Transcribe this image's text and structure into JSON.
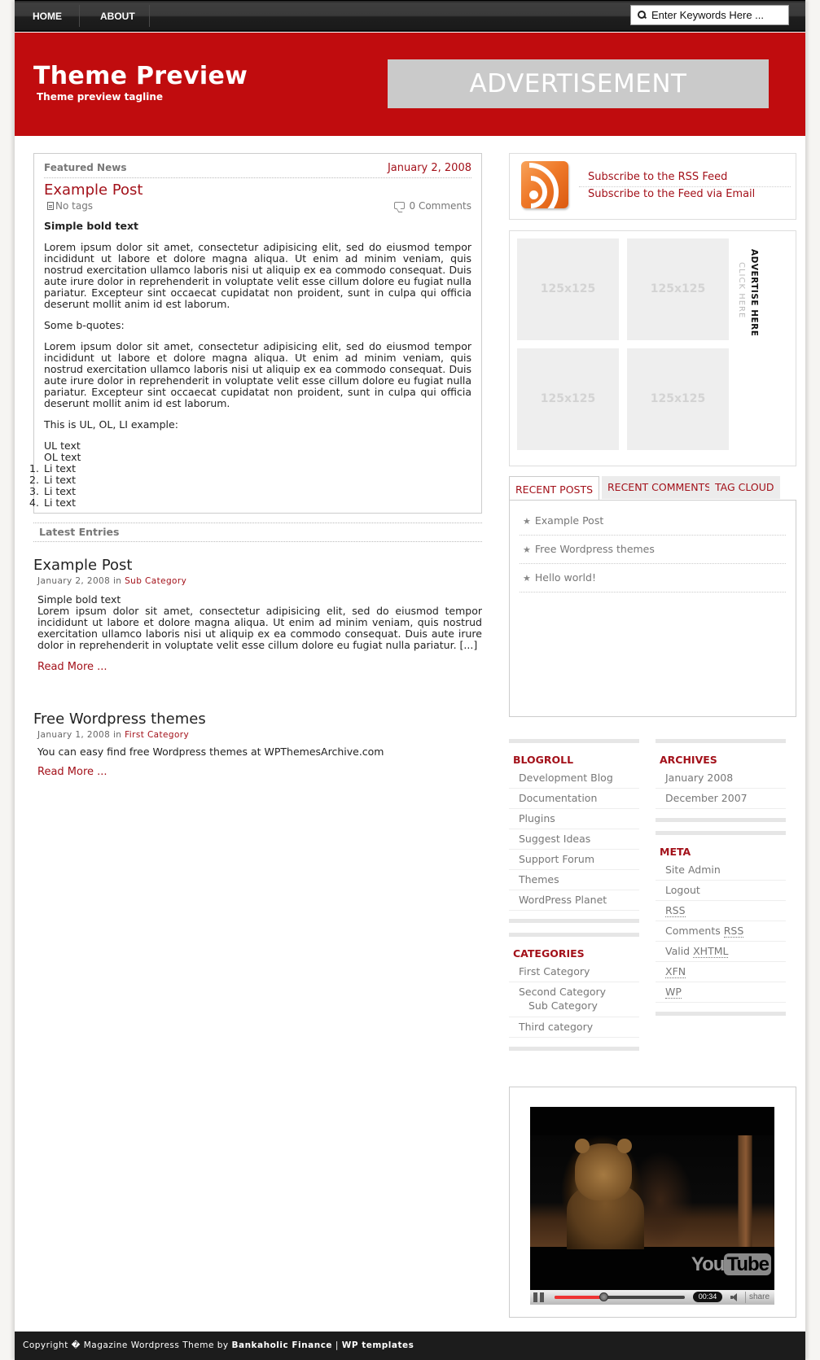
{
  "nav": {
    "items": [
      {
        "label": "HOME"
      },
      {
        "label": "ABOUT"
      }
    ],
    "search_placeholder": "Enter Keywords Here ..."
  },
  "header": {
    "title": "Theme Preview",
    "tagline": "Theme preview tagline",
    "ad_label": "ADVERTISEMENT"
  },
  "featured": {
    "section_label": "Featured News",
    "date": "January 2, 2008",
    "title": "Example Post",
    "tags": "No tags",
    "comments": "0 Comments",
    "bold_text": "Simple bold text",
    "paragraph1": "Lorem ipsum dolor sit amet, consectetur adipisicing elit, sed do eiusmod tempor incididunt ut labore et dolore magna aliqua. Ut enim ad minim veniam, quis nostrud exercitation ullamco laboris nisi ut aliquip ex ea commodo consequat. Duis aute irure dolor in reprehenderit in voluptate velit esse cillum dolore eu fugiat nulla pariatur. Excepteur sint occaecat cupidatat non proident, sunt in culpa qui officia deserunt mollit anim id est laborum.",
    "quotes_label": "Some b-quotes:",
    "paragraph2": "Lorem ipsum dolor sit amet, consectetur adipisicing elit, sed do eiusmod tempor incididunt ut labore et dolore magna aliqua. Ut enim ad minim veniam, quis nostrud exercitation ullamco laboris nisi ut aliquip ex ea commodo consequat. Duis aute irure dolor in reprehenderit in voluptate velit esse cillum dolore eu fugiat nulla pariatur. Excepteur sint occaecat cupidatat non proident, sunt in culpa qui officia deserunt mollit anim id est laborum.",
    "list_label": "This is UL, OL, LI example:",
    "ul_text": "UL text",
    "ol_text": "OL text",
    "list_items": [
      {
        "num": "1.",
        "text": "Li text"
      },
      {
        "num": "2.",
        "text": "Li text"
      },
      {
        "num": "3.",
        "text": "Li text"
      },
      {
        "num": "4.",
        "text": "Li text"
      }
    ]
  },
  "latest": {
    "heading": "Latest Entries",
    "entries": [
      {
        "title": "Example Post",
        "date": "January 2, 2008",
        "in": "in",
        "category": "Sub Category",
        "first_line": "Simple bold text",
        "excerpt": "Lorem ipsum dolor sit amet, consectetur adipisicing elit, sed do eiusmod tempor incididunt ut labore et dolore magna aliqua. Ut enim ad minim veniam, quis nostrud exercitation ullamco laboris nisi ut aliquip ex ea commodo consequat. Duis aute irure dolor in reprehenderit in voluptate velit esse cillum dolore eu fugiat nulla pariatur. [...]",
        "read_more": "Read More ..."
      },
      {
        "title": "Free Wordpress themes",
        "date": "January 1, 2008",
        "in": "in",
        "category": "First Category",
        "excerpt": "You can easy find free Wordpress themes at WPThemesArchive.com",
        "read_more": "Read More ..."
      }
    ]
  },
  "subscribe": {
    "rss_link": "Subscribe to the RSS Feed",
    "email_link": "Subscribe to the Feed via Email"
  },
  "ads": {
    "slots": [
      "125x125",
      "125x125",
      "125x125",
      "125x125"
    ],
    "advertise_here": "ADVERTISE HERE",
    "click_here": "CLICK HERE"
  },
  "tabs": {
    "labels": [
      "RECENT POSTS",
      "RECENT COMMENTS",
      "TAG CLOUD"
    ],
    "active": "RECENT POSTS",
    "recent_posts": [
      "Example Post",
      "Free Wordpress themes",
      "Hello world!"
    ]
  },
  "blogroll": {
    "title": "BLOGROLL",
    "items": [
      "Development Blog",
      "Documentation",
      "Plugins",
      "Suggest Ideas",
      "Support Forum",
      "Themes",
      "WordPress Planet"
    ]
  },
  "archives": {
    "title": "ARCHIVES",
    "items": [
      "January 2008",
      "December 2007"
    ]
  },
  "meta": {
    "title": "META",
    "items": [
      {
        "pre": "Site Admin",
        "abbr": ""
      },
      {
        "pre": "Logout",
        "abbr": ""
      },
      {
        "pre": "",
        "abbr": "RSS"
      },
      {
        "pre": "Comments ",
        "abbr": "RSS"
      },
      {
        "pre": "Valid ",
        "abbr": "XHTML"
      },
      {
        "pre": "",
        "abbr": "XFN"
      },
      {
        "pre": "",
        "abbr": "WP"
      }
    ]
  },
  "categories": {
    "title": "CATEGORIES",
    "items": [
      {
        "label": "First Category"
      },
      {
        "label": "Second Category",
        "sub": "Sub Category"
      },
      {
        "label": "Third category"
      }
    ]
  },
  "video": {
    "time": "00:34",
    "progress": 0.38,
    "brand_you": "You",
    "brand_tube": "Tube",
    "share_label": "share"
  },
  "footer": {
    "prefix": "Copyright � Magazine Wordpress Theme by ",
    "link1": "Bankaholic Finance",
    "separator": " | ",
    "link2": "WP templates"
  },
  "colors": {
    "brand_red": "#c00c0e",
    "link_red": "#a3111a",
    "nav_dark": "#1c1c1c"
  }
}
